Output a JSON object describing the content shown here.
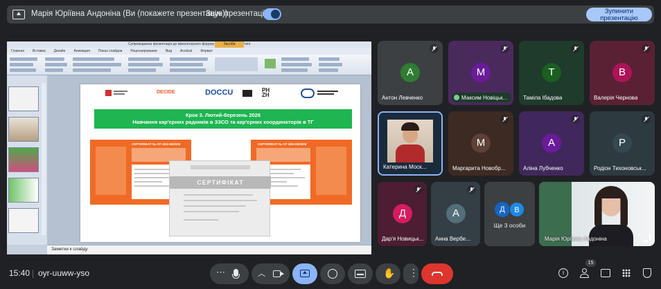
{
  "topbar": {
    "presenting_text": "Марія Юріївна Андоніна (Ви (покажете презентацію))",
    "sound_label": "Звук презентації",
    "stop_button": "Зупинити\nпрезентацію"
  },
  "shared_screen": {
    "ppt_window_title": "Супроводжена презентація до міжсекторного форуму - Microsoft PowerPoint",
    "ppt_context_tab": "Засоби рисования",
    "ppt_menu": [
      "Главная",
      "Вставка",
      "Дизайн",
      "Анимация",
      "Показ слайдов",
      "Рецензирование",
      "Вид",
      "Acrobat",
      "Формат"
    ],
    "notes_placeholder": "Заметки к слайду",
    "slide": {
      "logos": [
        "DECIDE",
        "DOCCU",
        "PH ZH"
      ],
      "band_line1": "Крок 3. Лютий-березень 2026",
      "band_line2": "Навчання кар'єрних радників в ЗЗСО та кар'єрних координаторів в ТГ",
      "cert_left_number": "СЕРТИФІКАТ № CP 18/4-06/2026",
      "cert_right_number": "СЕРТИФІКАТ № CP 18/4-06/2026",
      "cert_center_title": "СЕРТИФІКАТ"
    }
  },
  "participants": [
    {
      "name": "Антон Левченко",
      "initial": "А",
      "color": "#2e7d32",
      "muted": true
    },
    {
      "name": "Максим Новіцьк...",
      "initial": "M",
      "color": "#6a1b9a",
      "muted": true
    },
    {
      "name": "Таміла Ібадова",
      "initial": "T",
      "color": "#1b5e20",
      "muted": true
    },
    {
      "name": "Валерія Чернова",
      "initial": "B",
      "color": "#ad1457",
      "muted": true
    },
    {
      "name": "Катерина Моск...",
      "video": true,
      "muted": false
    },
    {
      "name": "Маргарита Новобр...",
      "initial": "M",
      "color": "#5d4037",
      "muted": true
    },
    {
      "name": "Аліна Лубченко",
      "initial": "A",
      "color": "#6a1b9a",
      "muted": true
    },
    {
      "name": "Родіон Тихоновськ...",
      "initial": "P",
      "color": "#37474f",
      "muted": true
    },
    {
      "name": "Дар'я Новицьк...",
      "initial": "Д",
      "color": "#d81b60",
      "muted": true
    },
    {
      "name": "Анна Вербе...",
      "initial": "A",
      "color": "#546e7a",
      "muted": true
    },
    {
      "name": "Ще 3 особи",
      "initials": [
        "Д",
        "В"
      ],
      "muted": false
    },
    {
      "name": "Марія Юріївна Андоніна",
      "video": true,
      "muted": false
    }
  ],
  "bottom_bar": {
    "time": "15:40",
    "meeting_code": "oyr-uuww-yso",
    "people_count": "15",
    "icons": [
      "more-options-icon",
      "mic-icon",
      "chevron-up-icon",
      "camera-icon",
      "present-icon",
      "emoji-icon",
      "captions-icon",
      "raise-hand-icon",
      "more-vert-icon",
      "end-call-icon",
      "info-icon",
      "people-icon",
      "chat-icon",
      "activities-icon",
      "host-controls-icon"
    ],
    "accent_present": "#8ab4f8",
    "end_call_color": "#dc362e"
  }
}
